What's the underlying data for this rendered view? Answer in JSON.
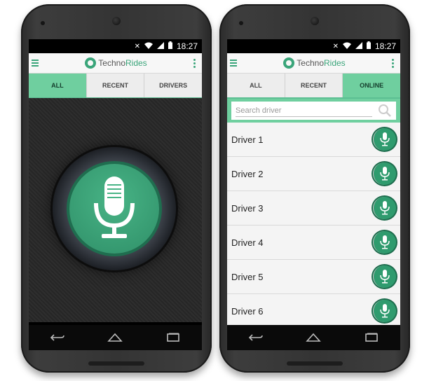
{
  "status_bar": {
    "time": "18:27"
  },
  "app": {
    "logo_part1": "Techno",
    "logo_part2": "Rides"
  },
  "left_screen": {
    "tabs": [
      {
        "label": "ALL",
        "active": true
      },
      {
        "label": "RECENT",
        "active": false
      },
      {
        "label": "DRIVERS",
        "active": false
      }
    ]
  },
  "right_screen": {
    "tabs": [
      {
        "label": "ALL",
        "active": false
      },
      {
        "label": "RECENT",
        "active": false
      },
      {
        "label": "ONLINE",
        "active": true
      }
    ],
    "search": {
      "placeholder": "Search driver"
    },
    "drivers": [
      "Driver 1",
      "Driver 2",
      "Driver 3",
      "Driver 4",
      "Driver 5",
      "Driver 6"
    ]
  },
  "colors": {
    "accent": "#6fcf9f",
    "mic_green": "#2f9b6e",
    "logo_green": "#3aa57a"
  },
  "icons": [
    "menu-icon",
    "overflow-menu-icon",
    "microphone-icon",
    "search-icon",
    "back-icon",
    "home-icon",
    "recents-icon",
    "mute-icon",
    "wifi-icon",
    "signal-icon",
    "battery-icon"
  ]
}
